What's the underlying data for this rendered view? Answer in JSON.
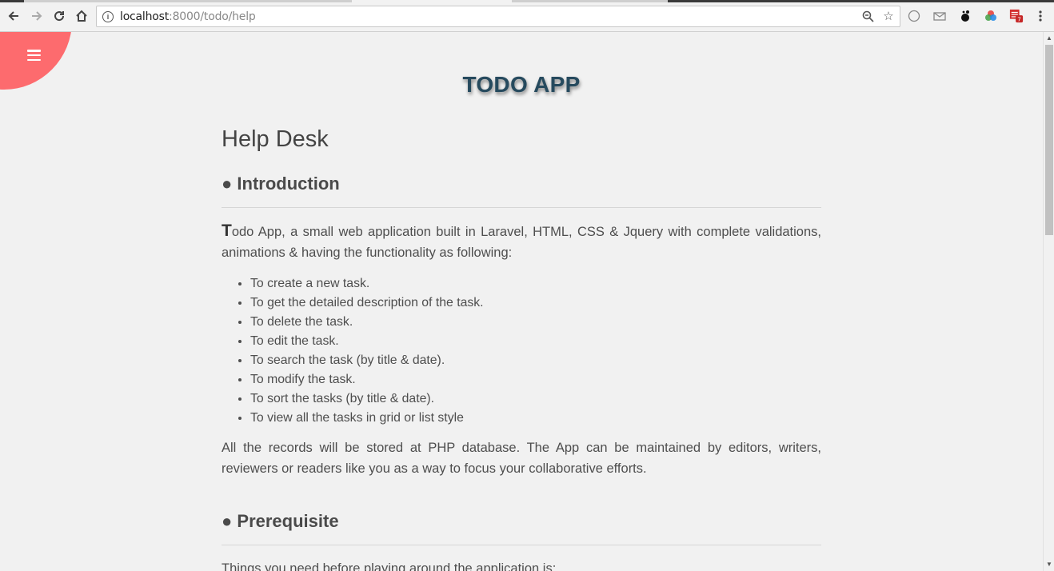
{
  "browser": {
    "url_host": "localhost",
    "url_rest": ":8000/todo/help"
  },
  "app": {
    "title": "TODO APP"
  },
  "help": {
    "page_heading": "Help Desk",
    "intro_heading": "● Introduction",
    "intro_first_letter": "T",
    "intro_text": "odo App, a small web application built in Laravel, HTML, CSS & Jquery with complete validations, animations & having the functionality as following:",
    "features": [
      "To create a new task.",
      "To get the detailed description of the task.",
      "To delete the task.",
      "To edit the task.",
      "To search the task (by title & date).",
      "To modify the task.",
      "To sort the tasks (by title & date).",
      "To view all the tasks in grid or list style"
    ],
    "records_text": "All the records will be stored at PHP database. The App can be maintained by editors, writers, reviewers or readers like you as a way to focus your collaborative efforts.",
    "prereq_heading": "● Prerequisite",
    "prereq_text": "Things you need before playing around the application is:"
  },
  "colors": {
    "menu_blob": "#fd6b6e",
    "title": "#264a5e"
  }
}
